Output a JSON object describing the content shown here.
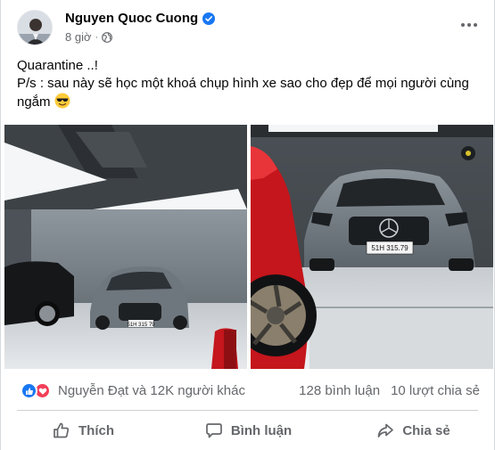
{
  "post": {
    "author_name": "Nguyen Quoc Cuong",
    "time": "8 giờ",
    "meta_separator": "·",
    "text_line1": "Quarantine ..!",
    "text_line2": "P/s : sau này sẽ học một khoá chụp hình xe sao cho đẹp để mọi người cùng ngắm",
    "emoji": "smiling-face-with-sunglasses",
    "photos": [
      {
        "plate_text": "51H 315 79"
      },
      {
        "plate_text": "51H 315.79"
      }
    ]
  },
  "reactions": {
    "names": "Nguyễn Đạt và 12K người khác",
    "comments": "128 bình luận",
    "shares": "10 lượt chia sẻ"
  },
  "actions": {
    "like": "Thích",
    "comment": "Bình luận",
    "share": "Chia sẻ"
  },
  "colors": {
    "accent": "#1877f2",
    "love": "#f33e58",
    "secondary_text": "#65676b"
  }
}
